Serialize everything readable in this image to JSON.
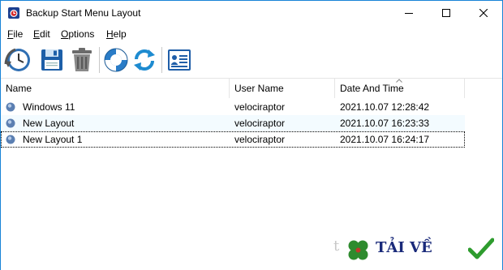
{
  "window": {
    "title": "Backup Start Menu Layout",
    "accent": "#1883d7"
  },
  "menu": [
    {
      "label": "File",
      "underline": "F",
      "rest": "ile"
    },
    {
      "label": "Edit",
      "underline": "E",
      "rest": "dit"
    },
    {
      "label": "Options",
      "underline": "O",
      "rest": "ptions"
    },
    {
      "label": "Help",
      "underline": "H",
      "rest": "elp"
    }
  ],
  "toolbar": {
    "buttons": [
      {
        "name": "backup-restore",
        "icon": "clock-restore-icon"
      },
      {
        "name": "save",
        "icon": "floppy-disk-icon"
      },
      {
        "name": "delete",
        "icon": "trash-can-icon"
      },
      {
        "name": "help",
        "icon": "lifebuoy-icon"
      },
      {
        "name": "refresh",
        "icon": "refresh-arrows-icon"
      },
      {
        "name": "about",
        "icon": "id-card-icon"
      }
    ]
  },
  "list": {
    "columns": [
      "Name",
      "User Name",
      "Date And Time"
    ],
    "sorted_column": "Date And Time",
    "rows": [
      {
        "name": "Windows 11",
        "user": "velociraptor",
        "datetime": "2021.10.07 12:28:42"
      },
      {
        "name": "New Layout",
        "user": "velociraptor",
        "datetime": "2021.10.07 16:23:33"
      },
      {
        "name": "New Layout 1",
        "user": "velociraptor",
        "datetime": "2021.10.07 16:24:17"
      }
    ]
  },
  "watermark": {
    "prefix": "t",
    "text": "TẢI VỀ",
    "icons": [
      "clover-icon",
      "checkmark-icon"
    ]
  }
}
